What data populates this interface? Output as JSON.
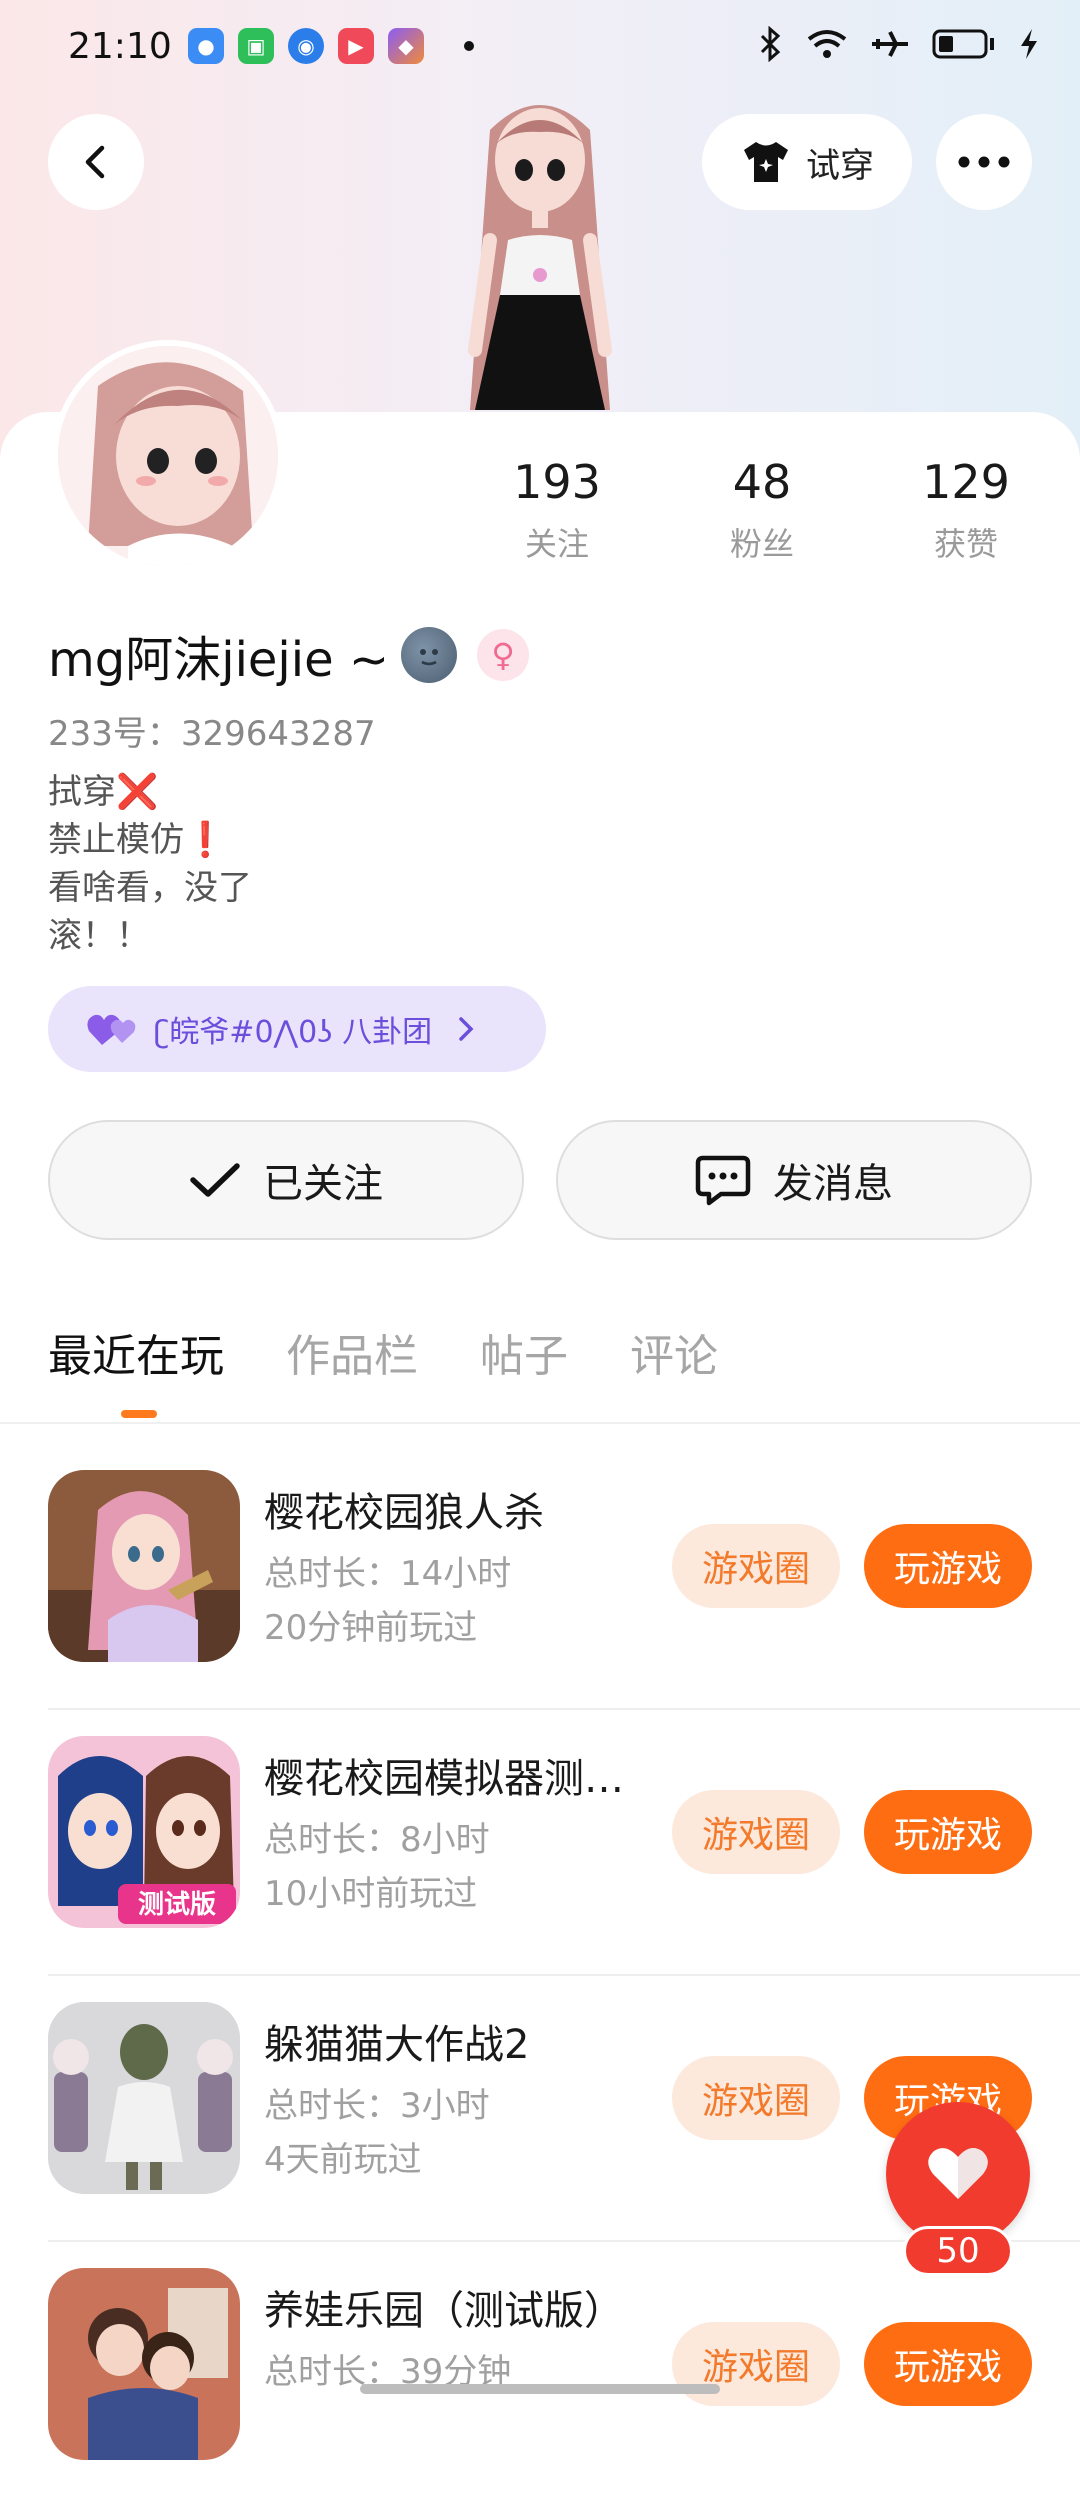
{
  "status_bar": {
    "time": "21:10"
  },
  "header": {
    "try_on_label": "试穿"
  },
  "profile": {
    "stats": [
      {
        "value": "193",
        "label": "关注"
      },
      {
        "value": "48",
        "label": "粉丝"
      },
      {
        "value": "129",
        "label": "获赞"
      }
    ],
    "name": "mg阿沫jiejie ~",
    "id_line": "233号：329643287",
    "bio": [
      "拭穿❌",
      "禁止模仿❗",
      "看啥看，没了",
      "滚！！"
    ],
    "group_label": "ʗ皖爷#0⋀0ʖ 八卦团",
    "follow_label": "已关注",
    "message_label": "发消息"
  },
  "tabs": [
    "最近在玩",
    "作品栏",
    "帖子",
    "评论"
  ],
  "games": [
    {
      "title": "樱花校园狼人杀",
      "duration": "总时长：14小时",
      "last_played": "20分钟前玩过",
      "circle_label": "游戏圈",
      "play_label": "玩游戏"
    },
    {
      "title": "樱花校园模拟器测试版",
      "duration": "总时长：8小时",
      "last_played": "10小时前玩过",
      "circle_label": "游戏圈",
      "play_label": "玩游戏"
    },
    {
      "title": "躲猫猫大作战2",
      "duration": "总时长：3小时",
      "last_played": "4天前玩过",
      "circle_label": "游戏圈",
      "play_label": "玩游戏"
    },
    {
      "title": "养娃乐园（测试版）",
      "duration": "总时长：39分钟",
      "last_played": "",
      "circle_label": "游戏圈",
      "play_label": "玩游戏"
    }
  ],
  "fab": {
    "count": "50"
  },
  "colors": {
    "accent": "#ff6d12",
    "accent_light": "#fde8dc",
    "fab": "#f23b2f",
    "group_bg": "#e9e4fb"
  }
}
